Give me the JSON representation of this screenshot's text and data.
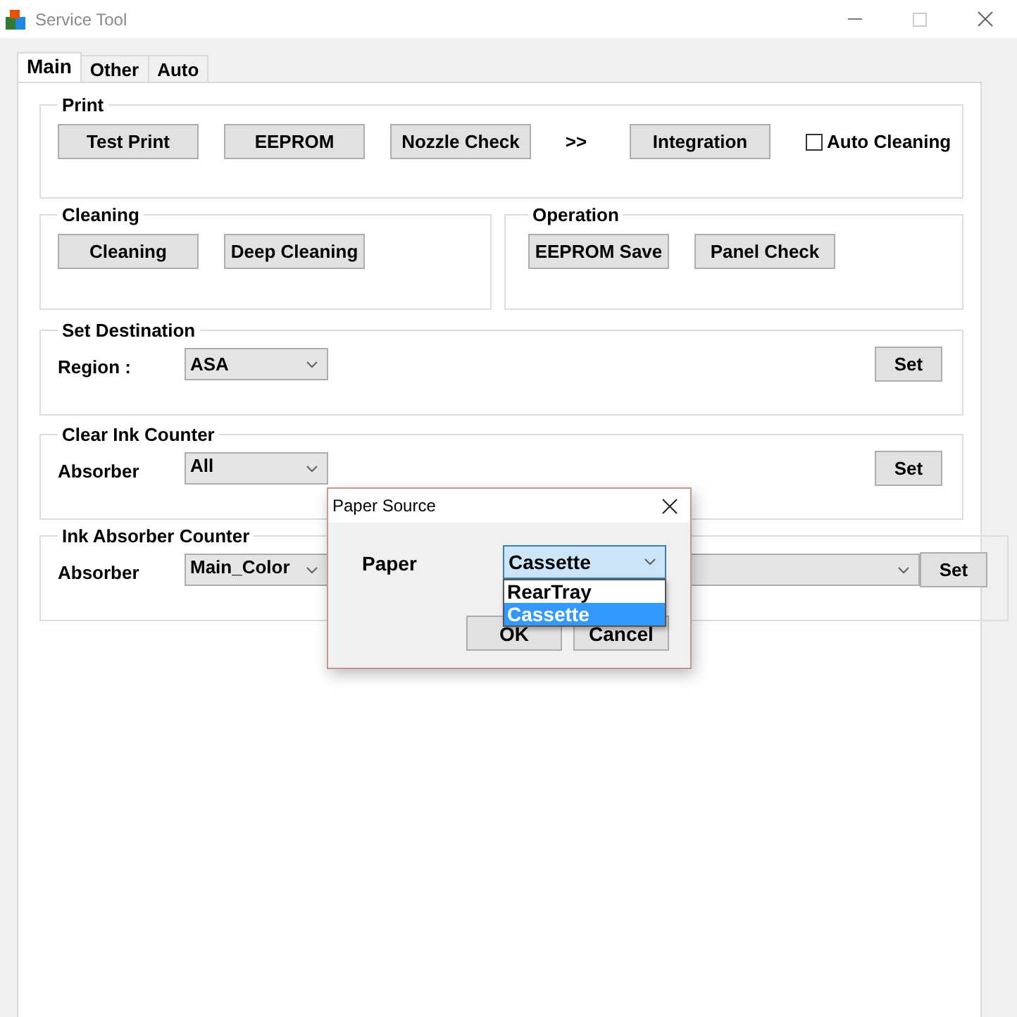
{
  "window": {
    "title": "Service Tool"
  },
  "tabs": [
    {
      "label": "Main",
      "selected": true
    },
    {
      "label": "Other",
      "selected": false
    },
    {
      "label": "Auto",
      "selected": false
    }
  ],
  "print": {
    "title": "Print",
    "buttons": [
      "Test Print",
      "EEPROM",
      "Nozzle Check"
    ],
    "separator": ">>",
    "next_button": "Integration",
    "checkbox": {
      "label": "Auto Cleaning",
      "checked": false
    }
  },
  "cleaning": {
    "title": "Cleaning",
    "buttons": [
      "Cleaning",
      "Deep Cleaning"
    ]
  },
  "operation": {
    "title": "Operation",
    "buttons": [
      "EEPROM Save",
      "Panel Check"
    ]
  },
  "set_destination": {
    "title": "Set Destination",
    "label": "Region :",
    "combo": "ASA",
    "button": "Set"
  },
  "clear_ink_counter": {
    "title": "Clear Ink Counter",
    "label": "Absorber",
    "combo": "All",
    "button": "Set"
  },
  "ink_absorber_counter": {
    "title": "Ink Absorber Counter",
    "label": "Absorber",
    "combo": "Main_Color",
    "button": "Set"
  },
  "dialog": {
    "title": "Paper Source",
    "label": "Paper",
    "combo": "Cassette",
    "options": [
      {
        "label": "RearTray",
        "selected": false
      },
      {
        "label": "Cassette",
        "selected": true
      }
    ],
    "buttons": [
      "OK",
      "Cancel"
    ]
  }
}
